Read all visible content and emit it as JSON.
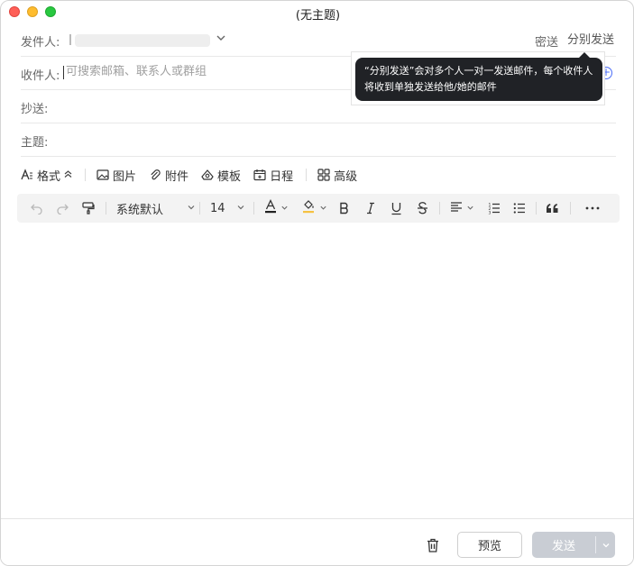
{
  "window": {
    "title": "(无主题)"
  },
  "header": {
    "sender_label": "发件人:",
    "bcc_label": "密送",
    "separate_send_label": "分别发送"
  },
  "recipients": {
    "to_label": "收件人:",
    "to_placeholder": "可搜索邮箱、联系人或群组",
    "cc_label": "抄送:",
    "subject_label": "主题:"
  },
  "tooltip": {
    "text": "“分别发送”会对多个人一对一发送邮件，每个收件人将收到单独发送给他/她的邮件"
  },
  "compose_toolbar": {
    "format": "格式",
    "image": "图片",
    "attachment": "附件",
    "template": "模板",
    "schedule": "日程",
    "advanced": "高级"
  },
  "format_bar": {
    "font_family": "系统默认",
    "font_size": "14",
    "colors": {
      "text": "#222222",
      "highlight": "#f5c242"
    }
  },
  "footer": {
    "preview": "预览",
    "send": "发送"
  },
  "icons": [
    "trash-icon",
    "undo-icon",
    "redo-icon",
    "format-painter-icon",
    "bold-icon",
    "italic-icon",
    "underline-icon",
    "strikethrough-icon",
    "align-icon",
    "ordered-list-icon",
    "bullet-list-icon",
    "quote-icon",
    "more-icon"
  ]
}
